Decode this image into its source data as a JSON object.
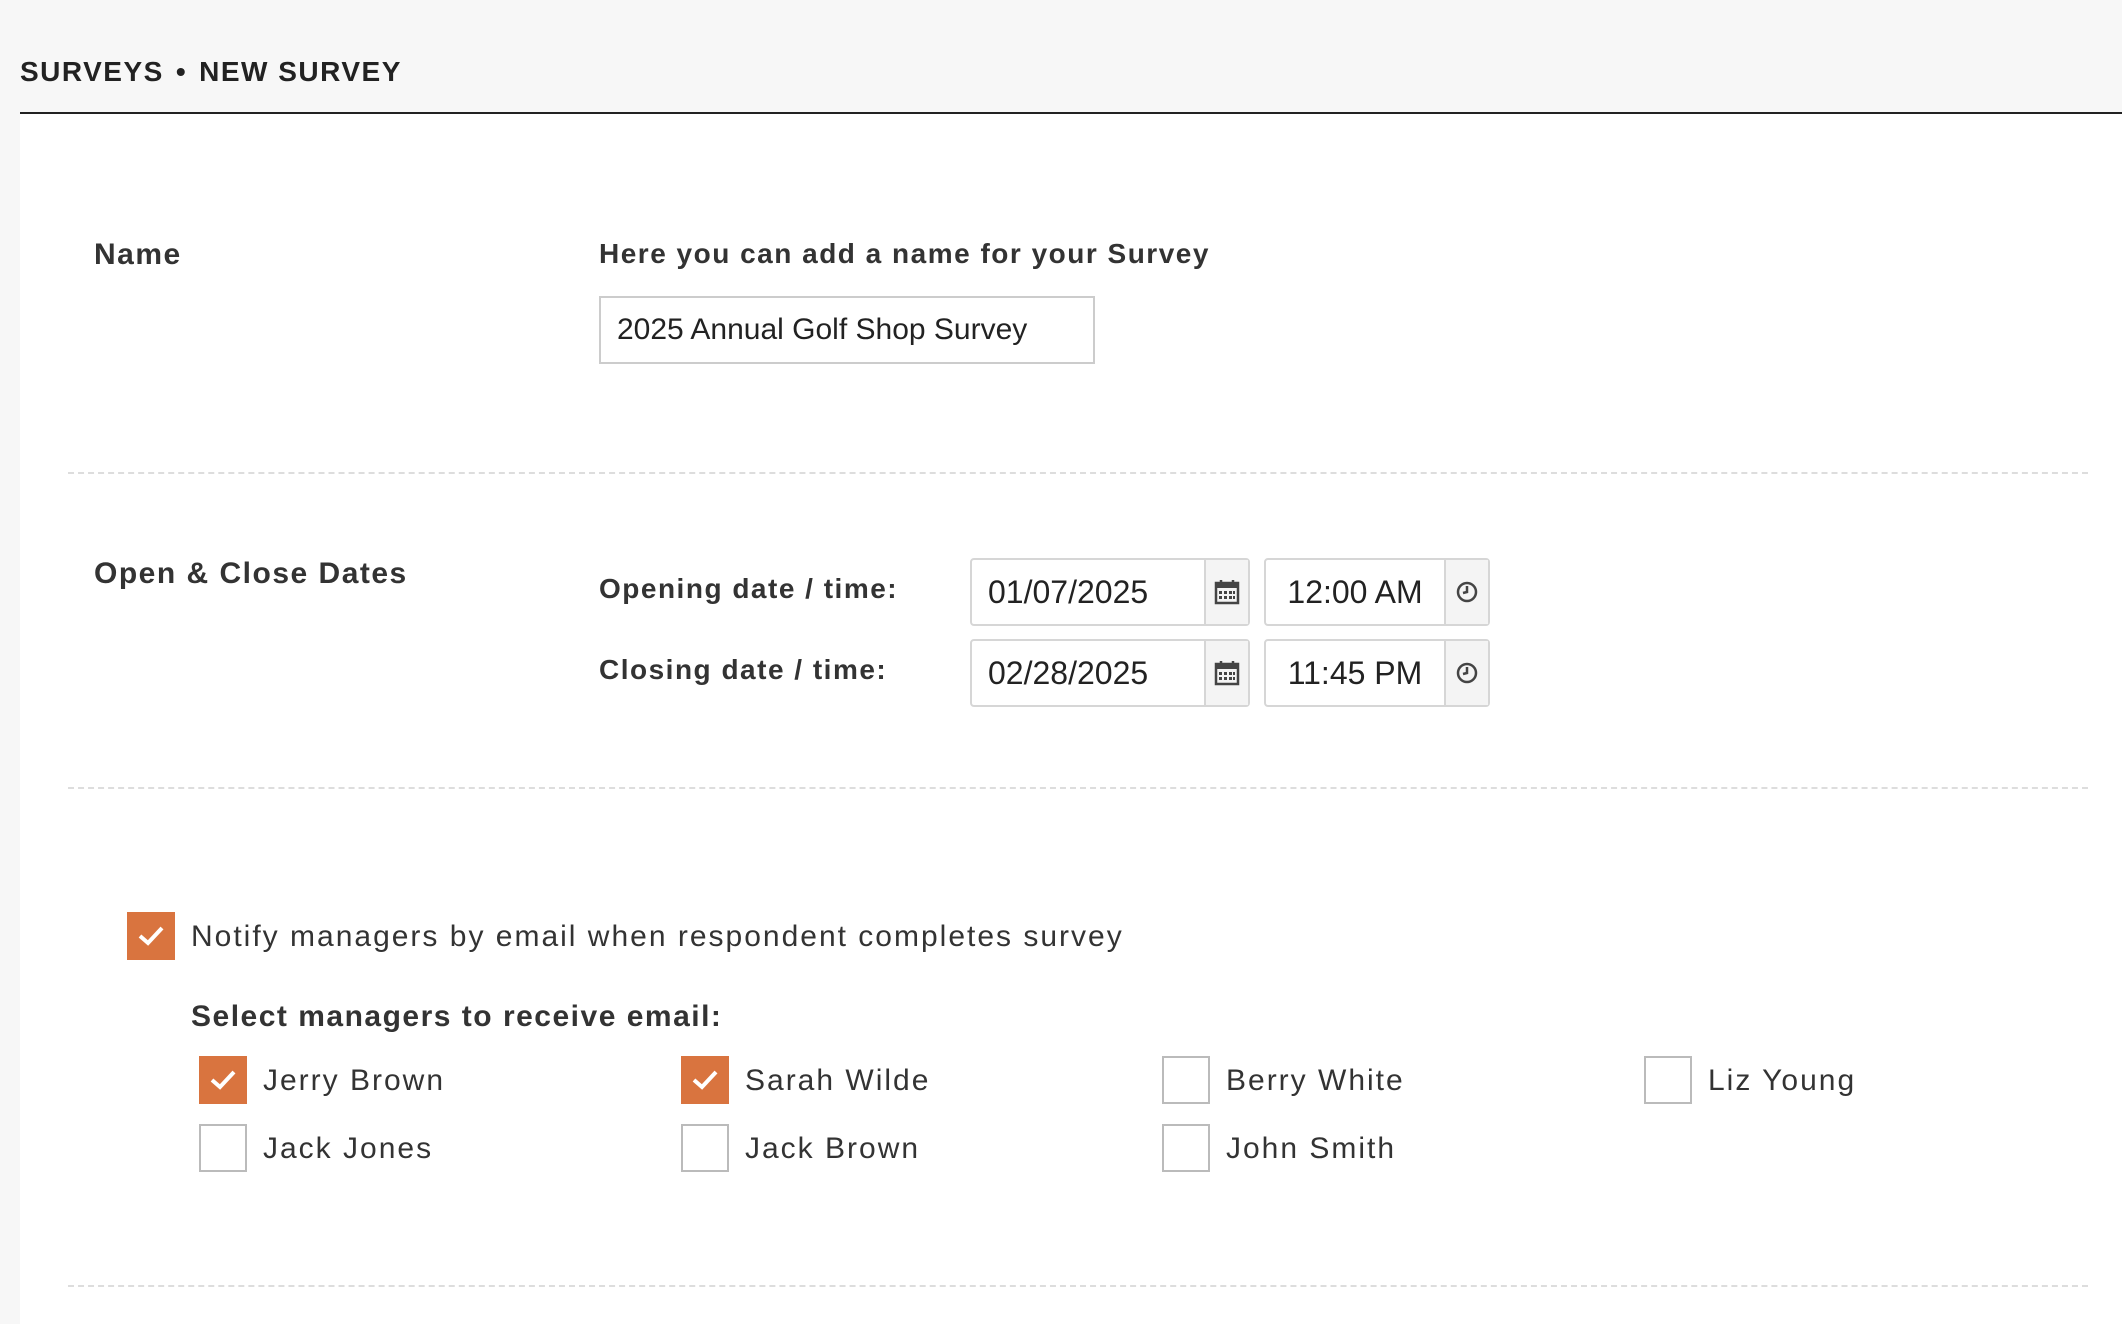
{
  "breadcrumb": {
    "root": "SURVEYS",
    "separator": "•",
    "current": "NEW SURVEY"
  },
  "name_section": {
    "label": "Name",
    "hint": "Here you can add a name for your Survey",
    "value": "2025 Annual Golf Shop Survey"
  },
  "dates_section": {
    "label": "Open & Close Dates",
    "opening": {
      "label": "Opening date / time:",
      "date": "01/07/2025",
      "time": "12:00 AM",
      "date_icon": "calendar-icon",
      "time_icon": "clock-icon"
    },
    "closing": {
      "label": "Closing date / time:",
      "date": "02/28/2025",
      "time": "11:45 PM",
      "date_icon": "calendar-icon",
      "time_icon": "clock-icon"
    }
  },
  "notify": {
    "label": "Notify managers by email when respondent completes survey",
    "checked": true,
    "select_label": "Select managers to receive email:",
    "managers": [
      {
        "name": "Jerry Brown",
        "checked": true
      },
      {
        "name": "Sarah Wilde",
        "checked": true
      },
      {
        "name": "Berry White",
        "checked": false
      },
      {
        "name": "Liz Young",
        "checked": false
      },
      {
        "name": "Jack Jones",
        "checked": false
      },
      {
        "name": "Jack Brown",
        "checked": false
      },
      {
        "name": "John Smith",
        "checked": false
      }
    ]
  },
  "colors": {
    "accent": "#d9743f",
    "page_bg": "#f7f7f7",
    "panel_bg": "#ffffff",
    "text": "#333333"
  }
}
